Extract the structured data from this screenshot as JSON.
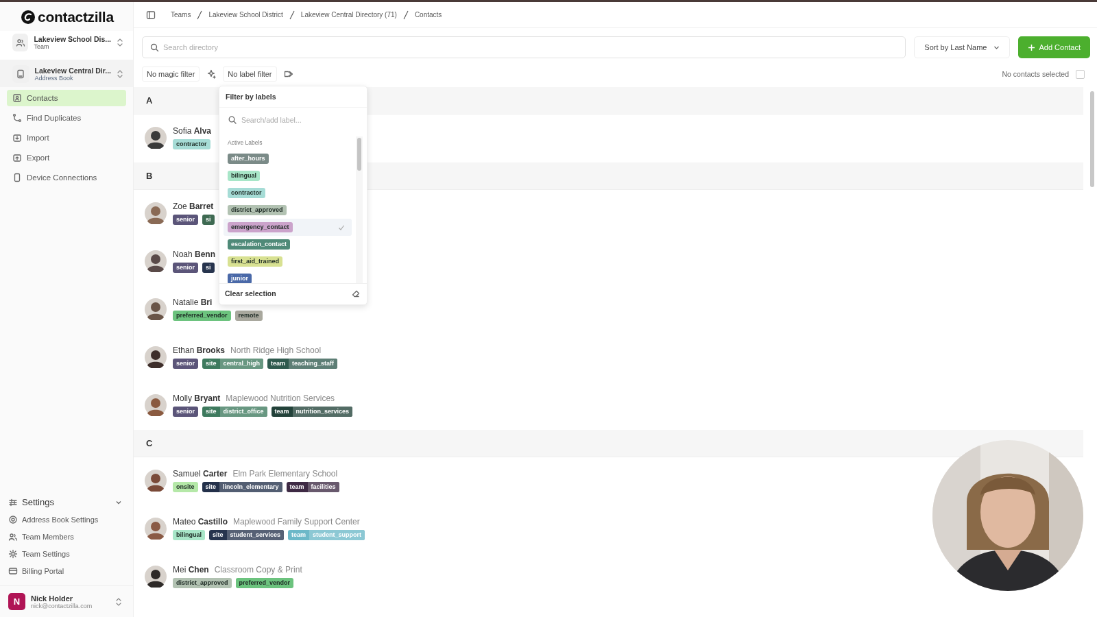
{
  "sidebar": {
    "logo": "contactzilla",
    "team": {
      "name": "Lakeview School Dis...",
      "type": "Team"
    },
    "address_book": {
      "name": "Lakeview Central Dir...",
      "type": "Address Book"
    },
    "nav": [
      {
        "label": "Contacts",
        "selected": true
      },
      {
        "label": "Find Duplicates",
        "selected": false
      },
      {
        "label": "Import",
        "selected": false
      },
      {
        "label": "Export",
        "selected": false
      },
      {
        "label": "Device Connections",
        "selected": false
      }
    ],
    "settings": {
      "label": "Settings",
      "expanded": true,
      "items": [
        {
          "label": "Address Book Settings"
        },
        {
          "label": "Team Members"
        },
        {
          "label": "Team Settings"
        },
        {
          "label": "Billing Portal"
        }
      ]
    },
    "user": {
      "initial": "N",
      "name": "Nick Holder",
      "email": "nick@contactzilla.com"
    }
  },
  "breadcrumbs": [
    "Teams",
    "Lakeview School District",
    "Lakeview Central Directory (71)",
    "Contacts"
  ],
  "search": {
    "placeholder": "Search directory"
  },
  "sort": {
    "label": "Sort by Last Name"
  },
  "add_button": "Add Contact",
  "filters": {
    "magic": "No magic filter",
    "label": "No label filter"
  },
  "selection": {
    "label": "No contacts selected",
    "checked": false
  },
  "sections": [
    {
      "letter": "A",
      "contacts": [
        {
          "first": "Sofia",
          "last": "Alva",
          "tags": [
            {
              "label": "contractor",
              "color": "#a6dcd6"
            }
          ]
        }
      ]
    },
    {
      "letter": "B",
      "contacts": [
        {
          "first": "Zoe",
          "last": "Barret",
          "tags": [
            {
              "label": "senior",
              "color": "#5b5579"
            },
            {
              "key": "si",
              "color": "#3e6a52"
            }
          ]
        },
        {
          "first": "Noah",
          "last": "Benn",
          "tags": [
            {
              "label": "senior",
              "color": "#5b5579"
            },
            {
              "key": "si",
              "color": "#27344e"
            }
          ]
        },
        {
          "first": "Natalie",
          "last": "Bri",
          "tags": [
            {
              "label": "preferred_vendor",
              "color": "#6cc37e"
            },
            {
              "label": "remote",
              "color": "#a9a89e"
            }
          ]
        },
        {
          "first": "Ethan",
          "last": "Brooks",
          "org": "North Ridge High School",
          "tags": [
            {
              "label": "senior",
              "color": "#5b5579"
            },
            {
              "key": "site",
              "value": "central_high",
              "color": "#3e7a5e"
            },
            {
              "key": "team",
              "value": "teaching_staff",
              "color": "#2f5a4e"
            }
          ]
        },
        {
          "first": "Molly",
          "last": "Bryant",
          "org": "Maplewood Nutrition Services",
          "tags": [
            {
              "label": "senior",
              "color": "#5b5579"
            },
            {
              "key": "site",
              "value": "district_office",
              "color": "#3e7a5e"
            },
            {
              "key": "team",
              "value": "nutrition_services",
              "color": "#23423a"
            }
          ]
        }
      ]
    },
    {
      "letter": "C",
      "contacts": [
        {
          "first": "Samuel",
          "last": "Carter",
          "org": "Elm Park Elementary School",
          "tags": [
            {
              "label": "onsite",
              "color": "#b5e8a8"
            },
            {
              "key": "site",
              "value": "lincoln_elementary",
              "color": "#23304a"
            },
            {
              "key": "team",
              "value": "facilities",
              "color": "#3e2a44"
            }
          ]
        },
        {
          "first": "Mateo",
          "last": "Castillo",
          "org": "Maplewood Family Support Center",
          "tags": [
            {
              "label": "bilingual",
              "color": "#a8e6c8"
            },
            {
              "key": "site",
              "value": "student_services",
              "color": "#27344e"
            },
            {
              "key": "team",
              "value": "student_support",
              "color": "#6cb8c8"
            }
          ]
        },
        {
          "first": "Mei",
          "last": "Chen",
          "org": "Classroom Copy & Print",
          "tags": [
            {
              "label": "district_approved",
              "color": "#b2c2b2"
            },
            {
              "label": "preferred_vendor",
              "color": "#6cc37e"
            }
          ]
        }
      ]
    }
  ],
  "label_menu": {
    "title": "Filter by labels",
    "placeholder": "Search/add label...",
    "group": "Active Labels",
    "labels": [
      {
        "label": "after_hours",
        "color": "#7b8b88",
        "selected": false
      },
      {
        "label": "bilingual",
        "color": "#a8e6c8",
        "selected": false
      },
      {
        "label": "contractor",
        "color": "#a6dcd6",
        "selected": false
      },
      {
        "label": "district_approved",
        "color": "#b2c2b2",
        "selected": false
      },
      {
        "label": "emergency_contact",
        "color": "#cba3cb",
        "selected": true
      },
      {
        "label": "escalation_contact",
        "color": "#4f8a78",
        "selected": false
      },
      {
        "label": "first_aid_trained",
        "color": "#d8e192",
        "selected": false
      },
      {
        "label": "junior",
        "color": "#4a69a8",
        "selected": false
      }
    ],
    "clear": "Clear selection"
  },
  "webcam": {
    "kind": "picture"
  }
}
